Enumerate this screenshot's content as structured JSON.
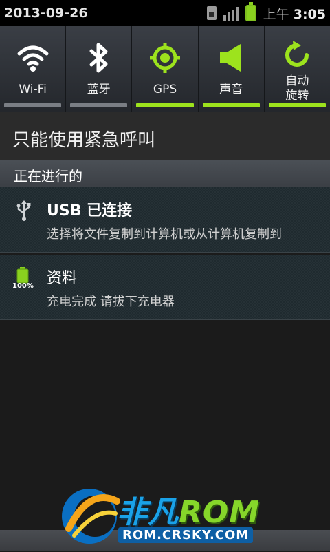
{
  "statusbar": {
    "date": "2013-09-26",
    "time_prefix": "上午",
    "time": "3:05",
    "icons": [
      "sim-icon",
      "signal-icon",
      "battery-icon"
    ],
    "battery_color": "#8ad11f"
  },
  "toggles": [
    {
      "id": "wifi",
      "label": "Wi-Fi",
      "icon": "wifi-icon",
      "on": false
    },
    {
      "id": "bluetooth",
      "label": "蓝牙",
      "icon": "bluetooth-icon",
      "on": false
    },
    {
      "id": "gps",
      "label": "GPS",
      "icon": "gps-icon",
      "on": true
    },
    {
      "id": "sound",
      "label": "声音",
      "icon": "speaker-icon",
      "on": true
    },
    {
      "id": "autorotate",
      "label_line1": "自动",
      "label_line2": "旋转",
      "icon": "rotate-icon",
      "on": true
    }
  ],
  "accent_color": "#9de31d",
  "emergency": {
    "text": "只能使用紧急呼叫"
  },
  "section": {
    "title": "正在进行的"
  },
  "notifications": [
    {
      "icon": "usb-icon",
      "title": "USB 已连接",
      "text": "选择将文件复制到计算机或从计算机复制到"
    },
    {
      "icon": "battery-full-icon",
      "icon_label": "100%",
      "title": "资料",
      "text": "充电完成 请拔下充电器"
    }
  ],
  "watermark": {
    "brand_cn": "非凡",
    "brand_en": "ROM",
    "url": "ROM.CRSKY.COM"
  }
}
